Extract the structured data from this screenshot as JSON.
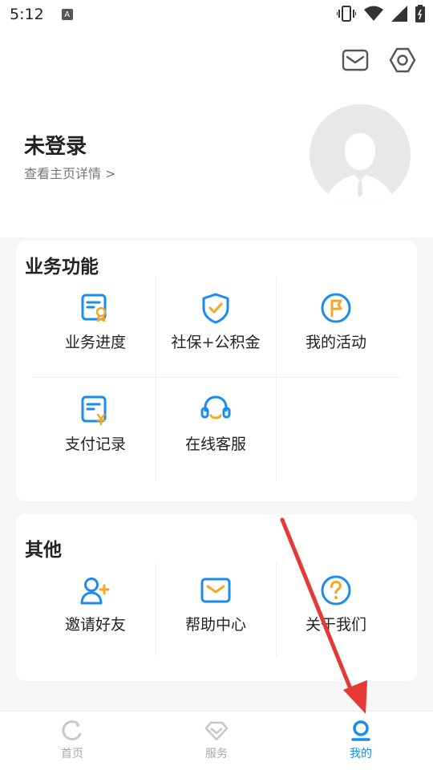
{
  "status_bar": {
    "time": "5:12",
    "indicator": "A"
  },
  "header": {
    "mail_icon": "mail-icon",
    "settings_icon": "gear-icon",
    "user_name": "未登录",
    "user_sub": "查看主页详情 >",
    "avatar_icon": "default-avatar-icon"
  },
  "business": {
    "title": "业务功能",
    "items": [
      {
        "label": "业务进度",
        "icon": "certificate-icon"
      },
      {
        "label": "社保+公积金",
        "icon": "shield-check-icon"
      },
      {
        "label": "我的活动",
        "icon": "flag-icon"
      },
      {
        "label": "支付记录",
        "icon": "payment-record-icon"
      },
      {
        "label": "在线客服",
        "icon": "headset-icon"
      }
    ]
  },
  "other": {
    "title": "其他",
    "items": [
      {
        "label": "邀请好友",
        "icon": "add-friend-icon"
      },
      {
        "label": "帮助中心",
        "icon": "mail-help-icon"
      },
      {
        "label": "关于我们",
        "icon": "question-icon"
      }
    ]
  },
  "tabbar": {
    "tabs": [
      {
        "label": "首页",
        "icon": "home-ring-icon",
        "active": false
      },
      {
        "label": "服务",
        "icon": "diamond-icon",
        "active": false
      },
      {
        "label": "我的",
        "icon": "person-icon",
        "active": true
      }
    ]
  },
  "colors": {
    "accent": "#1a8cf0",
    "highlight": "#f5a623",
    "annotation": "#e53935"
  }
}
